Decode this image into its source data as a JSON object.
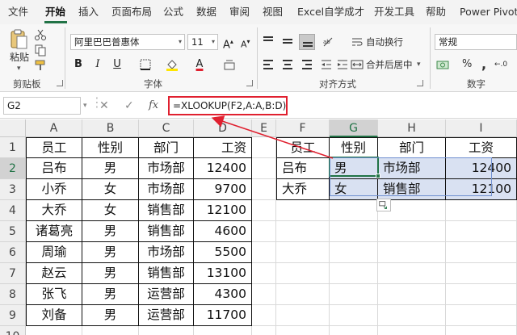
{
  "ribbon_tabs": [
    "文件",
    "开始",
    "插入",
    "页面布局",
    "公式",
    "数据",
    "审阅",
    "视图",
    "Excel自学成才",
    "开发工具",
    "帮助",
    "Power Pivot"
  ],
  "active_tab": "开始",
  "ribbon": {
    "clipboard": {
      "paste_label": "粘贴",
      "group_label": "剪贴板"
    },
    "font": {
      "font_name": "阿里巴巴普惠体",
      "font_size": "11",
      "bold": "B",
      "italic": "I",
      "underline": "U",
      "font_color_glyph": "A",
      "group_label": "字体"
    },
    "alignment": {
      "wrap_text": "自动换行",
      "merge_center": "合并后居中",
      "group_label": "对齐方式"
    },
    "number": {
      "format": "常规",
      "group_label": "数字"
    }
  },
  "formula_bar": {
    "name_box": "G2",
    "fx": "fx",
    "formula": "=XLOOKUP(F2,A:A,B:D)"
  },
  "grid": {
    "columns": [
      "A",
      "B",
      "C",
      "D",
      "E",
      "F",
      "G",
      "H",
      "I"
    ],
    "rows": [
      "1",
      "2",
      "3",
      "4",
      "5",
      "6",
      "7",
      "8",
      "9",
      "10"
    ],
    "active_column": "G",
    "active_row": "2",
    "left_table": {
      "headers": [
        "员工",
        "性别",
        "部门",
        "工资"
      ],
      "rows": [
        [
          "吕布",
          "男",
          "市场部",
          "12400"
        ],
        [
          "小乔",
          "女",
          "市场部",
          "9700"
        ],
        [
          "大乔",
          "女",
          "销售部",
          "12100"
        ],
        [
          "诸葛亮",
          "男",
          "销售部",
          "4600"
        ],
        [
          "周瑜",
          "男",
          "市场部",
          "5500"
        ],
        [
          "赵云",
          "男",
          "销售部",
          "13100"
        ],
        [
          "张飞",
          "男",
          "运营部",
          "4300"
        ],
        [
          "刘备",
          "男",
          "运营部",
          "11700"
        ]
      ]
    },
    "right_table": {
      "headers": [
        "员工",
        "性别",
        "部门",
        "工资"
      ],
      "rows": [
        [
          "吕布",
          "男",
          "市场部",
          "12400"
        ],
        [
          "大乔",
          "女",
          "销售部",
          "12100"
        ]
      ]
    }
  },
  "colors": {
    "accent": "#217346",
    "formula_highlight": "#e0202f",
    "spill_fill": "#d9e1f2"
  }
}
